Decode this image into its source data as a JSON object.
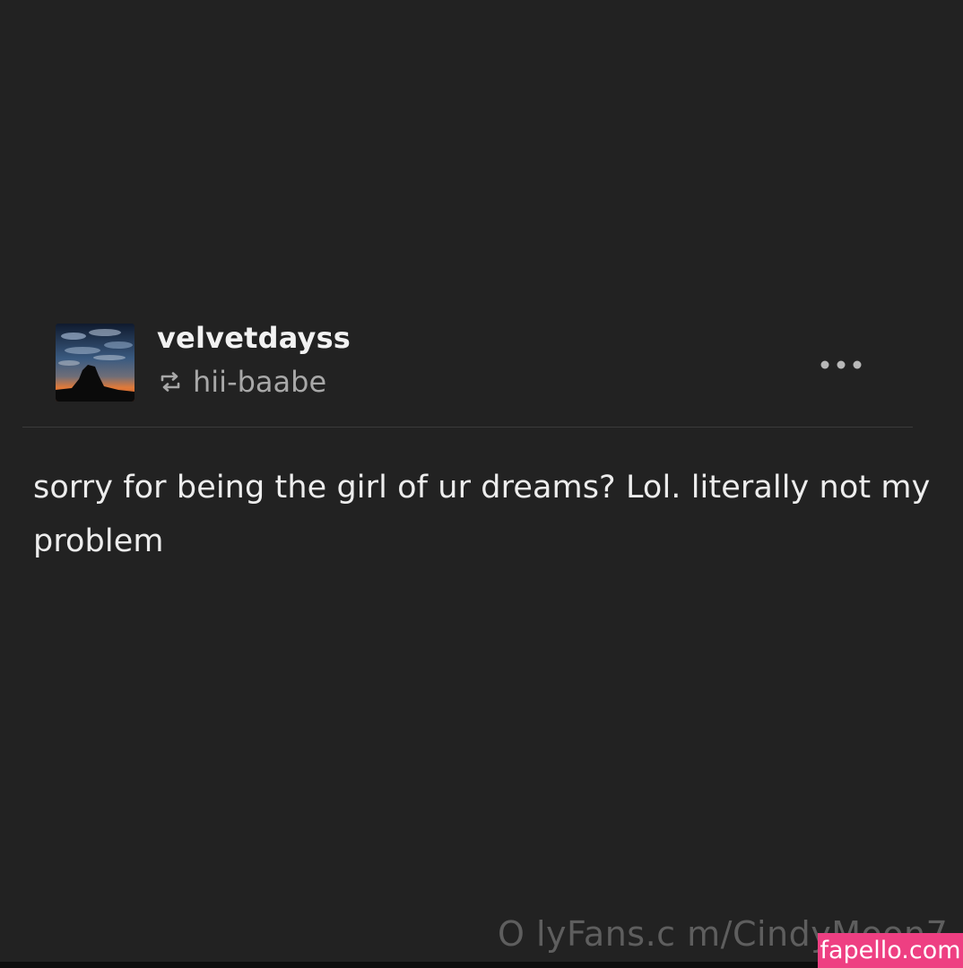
{
  "post": {
    "username": "velvetdayss",
    "reblogged_from": "hii-baabe",
    "body": "sorry for being the girl of ur dreams? Lol. literally not my problem",
    "avatar_icon": "sunset-silhouette-avatar",
    "reblog_icon": "reblog-icon",
    "more_icon": "more-options-icon"
  },
  "watermark": {
    "text": "O lyFans.c m/CindyMoon7",
    "badge": "fapello.com",
    "badge_color": "#ee3f82"
  },
  "colors": {
    "background": "#222222",
    "text_primary": "#ececec",
    "text_secondary": "#a8a8a8",
    "divider": "#3b3b3b"
  }
}
